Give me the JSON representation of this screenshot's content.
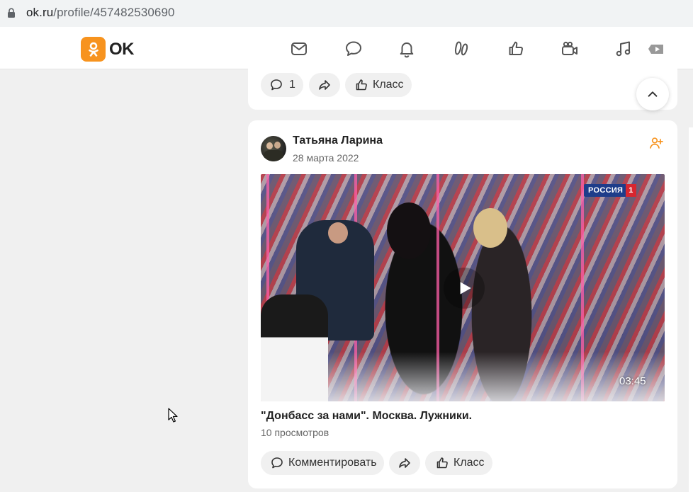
{
  "browser": {
    "url_host": "ok.ru",
    "url_path": "/profile/457482530690",
    "lock_icon": "lock-icon"
  },
  "header": {
    "logo_text": "OK",
    "brand_color": "#f7931e",
    "nav": [
      {
        "name": "messages-icon"
      },
      {
        "name": "discussions-icon"
      },
      {
        "name": "notifications-icon"
      },
      {
        "name": "guests-icon"
      },
      {
        "name": "events-icon"
      },
      {
        "name": "video-icon"
      },
      {
        "name": "music-icon"
      },
      {
        "name": "tv-icon"
      }
    ]
  },
  "top_post": {
    "comment_count": "1",
    "like_label": "Класс"
  },
  "post": {
    "author": "Татьяна Ларина",
    "date": "28 марта 2022",
    "video": {
      "channel_name": "РОССИЯ",
      "channel_number": "1",
      "duration": "03:45",
      "title": "\"Донбасс за нами\". Москва. Лужники.",
      "views": "10 просмотров"
    },
    "actions": {
      "comment_label": "Комментировать",
      "like_label": "Класс"
    }
  }
}
